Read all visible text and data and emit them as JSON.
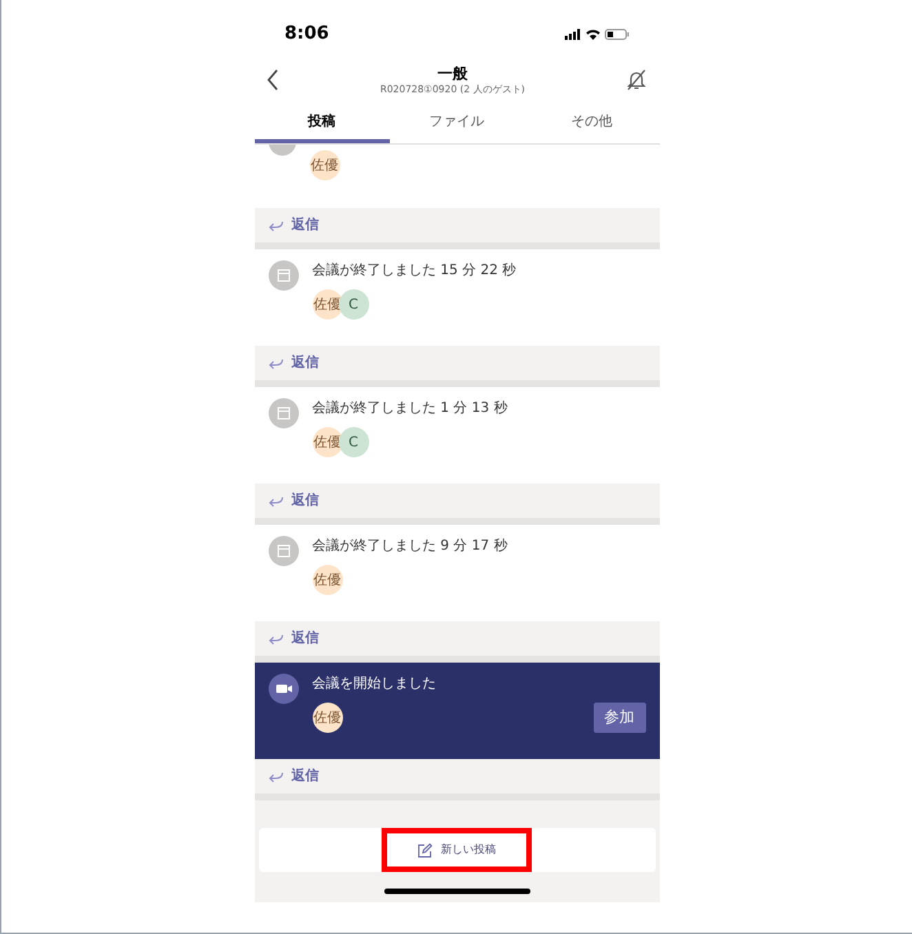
{
  "status_bar": {
    "time": "8:06"
  },
  "header": {
    "title": "一般",
    "subtitle": "R020728①0920 (2 人のゲスト)"
  },
  "tabs": [
    {
      "label": "投稿",
      "selected": true
    },
    {
      "label": "ファイル",
      "selected": false
    },
    {
      "label": "その他",
      "selected": false
    }
  ],
  "threads": [
    {
      "kind": "cut",
      "avatars": [
        {
          "initials": "佐優",
          "color": "#fde4c8"
        }
      ],
      "reply": "返信"
    },
    {
      "kind": "ended",
      "message": "会議が終了しました 15 分 22 秒",
      "avatars": [
        {
          "initials": "佐優",
          "color": "#fde4c8"
        },
        {
          "initials": "C",
          "color": "#cde3d3"
        }
      ],
      "reply": "返信"
    },
    {
      "kind": "ended",
      "message": "会議が終了しました 1 分 13 秒",
      "avatars": [
        {
          "initials": "佐優",
          "color": "#fde4c8"
        },
        {
          "initials": "C",
          "color": "#cde3d3"
        }
      ],
      "reply": "返信"
    },
    {
      "kind": "ended",
      "message": "会議が終了しました 9 分 17 秒",
      "avatars": [
        {
          "initials": "佐優",
          "color": "#fde4c8"
        }
      ],
      "reply": "返信"
    },
    {
      "kind": "started",
      "message": "会議を開始しました",
      "avatars": [
        {
          "initials": "佐優",
          "color": "#fde4c8"
        }
      ],
      "join": "参加",
      "reply": "返信"
    }
  ],
  "new_post": {
    "label": "新しい投稿",
    "highlighted": true
  }
}
